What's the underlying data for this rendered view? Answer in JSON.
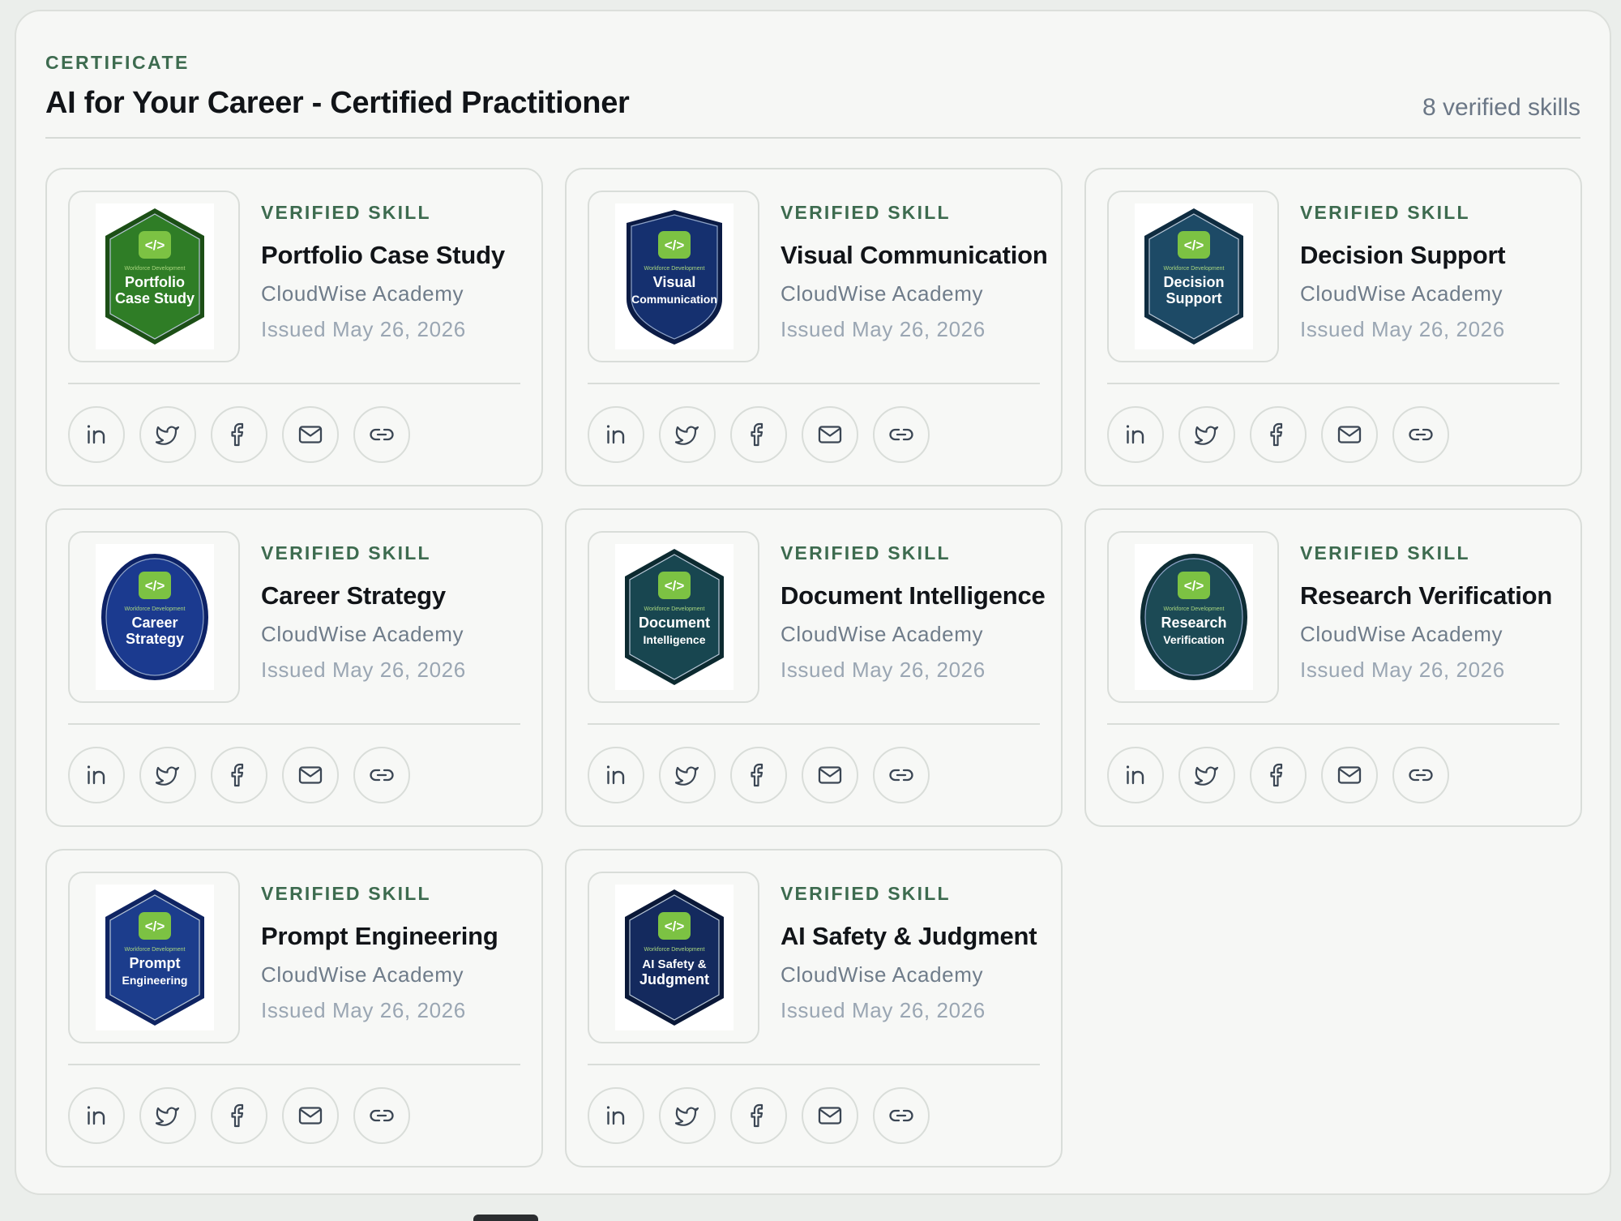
{
  "header": {
    "eyebrow": "CERTIFICATE",
    "title": "AI for Your Career - Certified Practitioner",
    "skills_count": "8 verified skills"
  },
  "colors": {
    "accent_green": "#3d6b4f",
    "title": "#111418",
    "muted": "#6f7c8a",
    "faint": "#9aa6b3"
  },
  "cards": [
    {
      "eyebrow": "VERIFIED SKILL",
      "name": "Portfolio Case Study",
      "issuer": "CloudWise Academy",
      "issued": "Issued May 26, 2026",
      "badge": {
        "shape": "hexagon",
        "color": "#2f7d26",
        "dark": "#1c4f16",
        "line1": "Portfolio",
        "line2": "Case Study",
        "kicker": "Workforce Development"
      }
    },
    {
      "eyebrow": "VERIFIED SKILL",
      "name": "Visual Communication",
      "issuer": "CloudWise Academy",
      "issued": "Issued May 26, 2026",
      "badge": {
        "shape": "shield",
        "color": "#15306f",
        "dark": "#0b1b45",
        "line1": "Visual",
        "line2": "Communication",
        "kicker": "Workforce Development"
      }
    },
    {
      "eyebrow": "VERIFIED SKILL",
      "name": "Decision Support",
      "issuer": "CloudWise Academy",
      "issued": "Issued May 26, 2026",
      "badge": {
        "shape": "hexagon",
        "color": "#1d4a66",
        "dark": "#0f2c40",
        "line1": "Decision",
        "line2": "Support",
        "kicker": "Workforce Development"
      }
    },
    {
      "eyebrow": "VERIFIED SKILL",
      "name": "Career Strategy",
      "issuer": "CloudWise Academy",
      "issued": "Issued May 26, 2026",
      "badge": {
        "shape": "circle",
        "color": "#1b3a8f",
        "dark": "#0d2266",
        "line1": "Career",
        "line2": "Strategy",
        "kicker": "Workforce Development"
      }
    },
    {
      "eyebrow": "VERIFIED SKILL",
      "name": "Document Intelligence",
      "issuer": "CloudWise Academy",
      "issued": "Issued May 26, 2026",
      "badge": {
        "shape": "hexagon",
        "color": "#184650",
        "dark": "#0c2a30",
        "line1": "Document",
        "line2": "Intelligence",
        "kicker": "Workforce Development"
      }
    },
    {
      "eyebrow": "VERIFIED SKILL",
      "name": "Research Verification",
      "issuer": "CloudWise Academy",
      "issued": "Issued May 26, 2026",
      "badge": {
        "shape": "circle",
        "color": "#1c4a55",
        "dark": "#0e2d35",
        "line1": "Research",
        "line2": "Verification",
        "kicker": "Workforce Development"
      }
    },
    {
      "eyebrow": "VERIFIED SKILL",
      "name": "Prompt Engineering",
      "issuer": "CloudWise Academy",
      "issued": "Issued May 26, 2026",
      "badge": {
        "shape": "hexagon",
        "color": "#1c3d8c",
        "dark": "#0f2462",
        "line1": "Prompt",
        "line2": "Engineering",
        "kicker": "Workforce Development"
      }
    },
    {
      "eyebrow": "VERIFIED SKILL",
      "name": "AI Safety & Judgment",
      "issuer": "CloudWise Academy",
      "issued": "Issued May 26, 2026",
      "badge": {
        "shape": "hexagon",
        "color": "#142a5e",
        "dark": "#0a1838",
        "line1": "AI Safety &",
        "line2": "Judgment",
        "kicker": "Workforce Development"
      }
    }
  ],
  "share_actions": [
    {
      "icon": "linkedin-icon"
    },
    {
      "icon": "twitter-icon"
    },
    {
      "icon": "facebook-icon"
    },
    {
      "icon": "email-icon"
    },
    {
      "icon": "link-icon"
    }
  ]
}
